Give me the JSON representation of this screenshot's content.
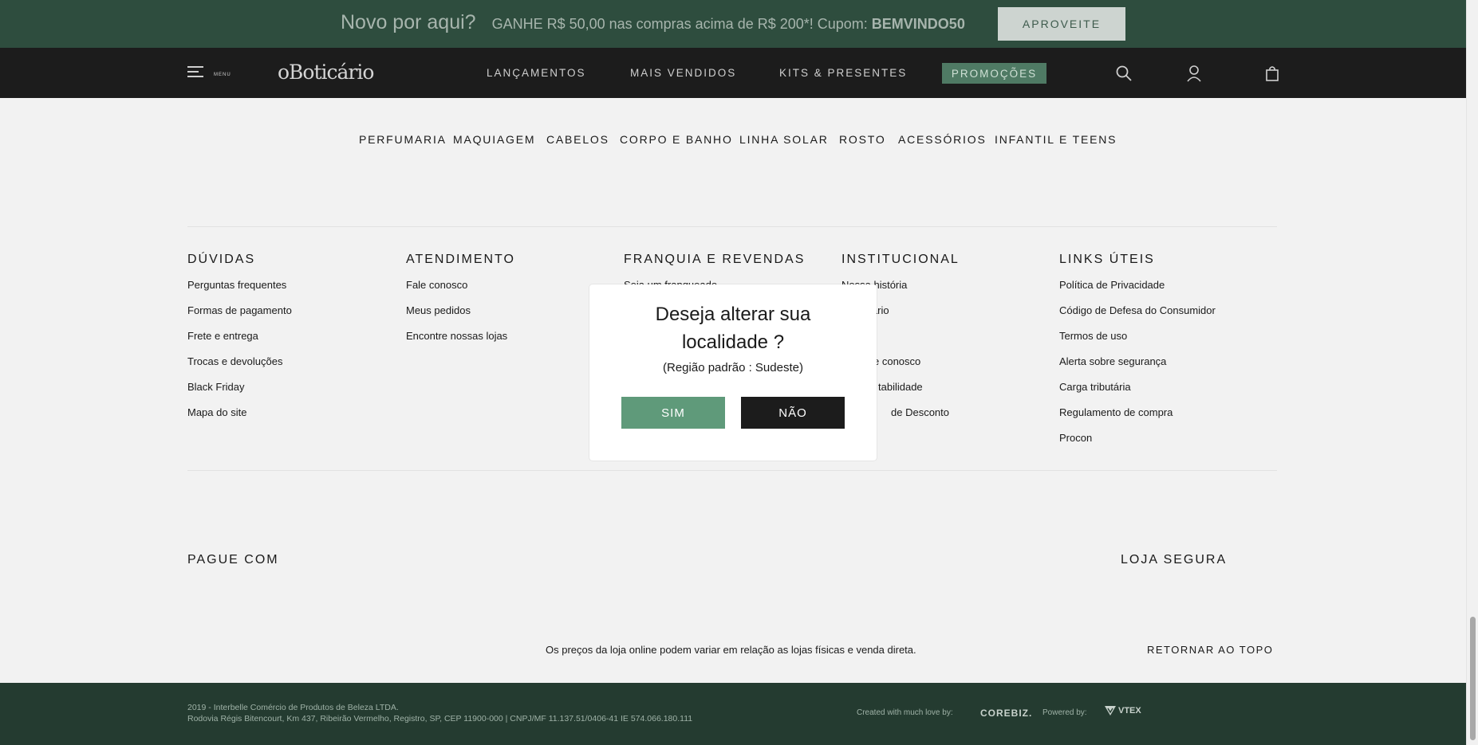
{
  "colors": {
    "promo_bg": "#2e4d3e",
    "header_bg": "#1c1c1c",
    "accent": "#5f9a7a",
    "bottom_bg": "#243b30"
  },
  "promo": {
    "headline": "Novo por aqui?",
    "text": "GANHE R$ 50,00 nas compras acima de R$ 200*! Cupom: ",
    "code": "BEMVINDO50",
    "button": "APROVEITE"
  },
  "header": {
    "menu_label": "MENU",
    "logo": "oBoticário",
    "nav": [
      "LANÇAMENTOS",
      "MAIS VENDIDOS",
      "KITS & PRESENTES"
    ],
    "promo_nav": "PROMOÇÕES",
    "icons": [
      "search-icon",
      "user-icon",
      "bag-icon"
    ]
  },
  "categories": [
    "PERFUMARIA",
    "MAQUIAGEM",
    "CABELOS",
    "CORPO E BANHO",
    "LINHA SOLAR",
    "ROSTO",
    "ACESSÓRIOS",
    "INFANTIL E TEENS"
  ],
  "footer": {
    "columns": [
      {
        "title": "DÚVIDAS",
        "links": [
          "Perguntas frequentes",
          "Formas de pagamento",
          "Frete e entrega",
          "Trocas e devoluções",
          "Black Friday",
          "Mapa do site"
        ]
      },
      {
        "title": "ATENDIMENTO",
        "links": [
          "Fale conosco",
          "Meus pedidos",
          "Encontre nossas lojas"
        ]
      },
      {
        "title": "FRANQUIA E REVENDAS",
        "links": [
          "Seja um franqueado"
        ]
      },
      {
        "title": "INSTITUCIONAL",
        "links": [
          "Nossa história",
          "Boticário",
          "",
          "e conosco",
          "tabilidade",
          "de Desconto"
        ]
      },
      {
        "title": "LINKS ÚTEIS",
        "links": [
          "Política de Privacidade",
          "Código de Defesa do Consumidor",
          "Termos de uso",
          "Alerta sobre segurança",
          "Carga tributária",
          "Regulamento de compra",
          "Procon"
        ]
      }
    ],
    "pay_title": "PAGUE COM",
    "secure_title": "LOJA SEGURA",
    "price_note": "Os preços da loja online podem variar em relação as lojas físicas e venda direta.",
    "back_to_top": "RETORNAR AO TOPO"
  },
  "bottom": {
    "legal_line1": "2019 - Interbelle Comércio de Produtos de Beleza LTDA.",
    "legal_line2": "Rodovia Régis Bitencourt, Km 437, Ribeirão Vermelho, Registro, SP, CEP 11900-000 | CNPJ/MF 11.137.51/0406-41 IE 574.066.180.111",
    "created_label": "Created with much love by:",
    "corebiz": "COREBIZ.",
    "powered_label": "Powered by:",
    "vtex": "VTEX"
  },
  "modal": {
    "title_line1": "Deseja alterar sua",
    "title_line2": "localidade ?",
    "subtitle": "(Região padrão : Sudeste)",
    "yes": "SIM",
    "no": "NÃO"
  }
}
